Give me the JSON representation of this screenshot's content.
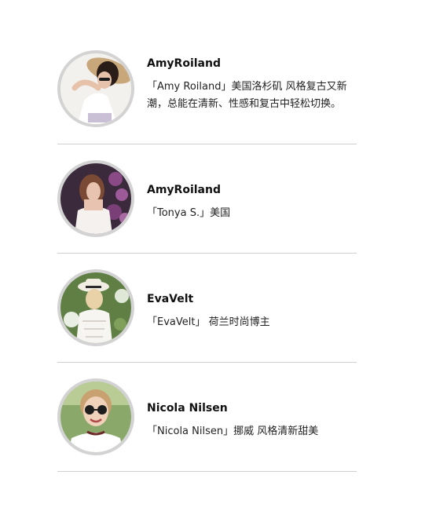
{
  "profiles": [
    {
      "name": "AmyRoiland",
      "description": "「Amy Roiland」美国洛杉矶 风格复古又新潮，总能在清新、性感和复古中轻松切换。"
    },
    {
      "name": "AmyRoiland",
      "description": "「Tonya S.」美国"
    },
    {
      "name": "EvaVelt",
      "description": "「EvaVelt」 荷兰时尚博主"
    },
    {
      "name": "Nicola Nilsen",
      "description": "「Nicola Nilsen」挪威 风格清新甜美"
    }
  ],
  "colors": {
    "avatar_border": "#d3d3d3",
    "divider": "#cfcfcf"
  }
}
